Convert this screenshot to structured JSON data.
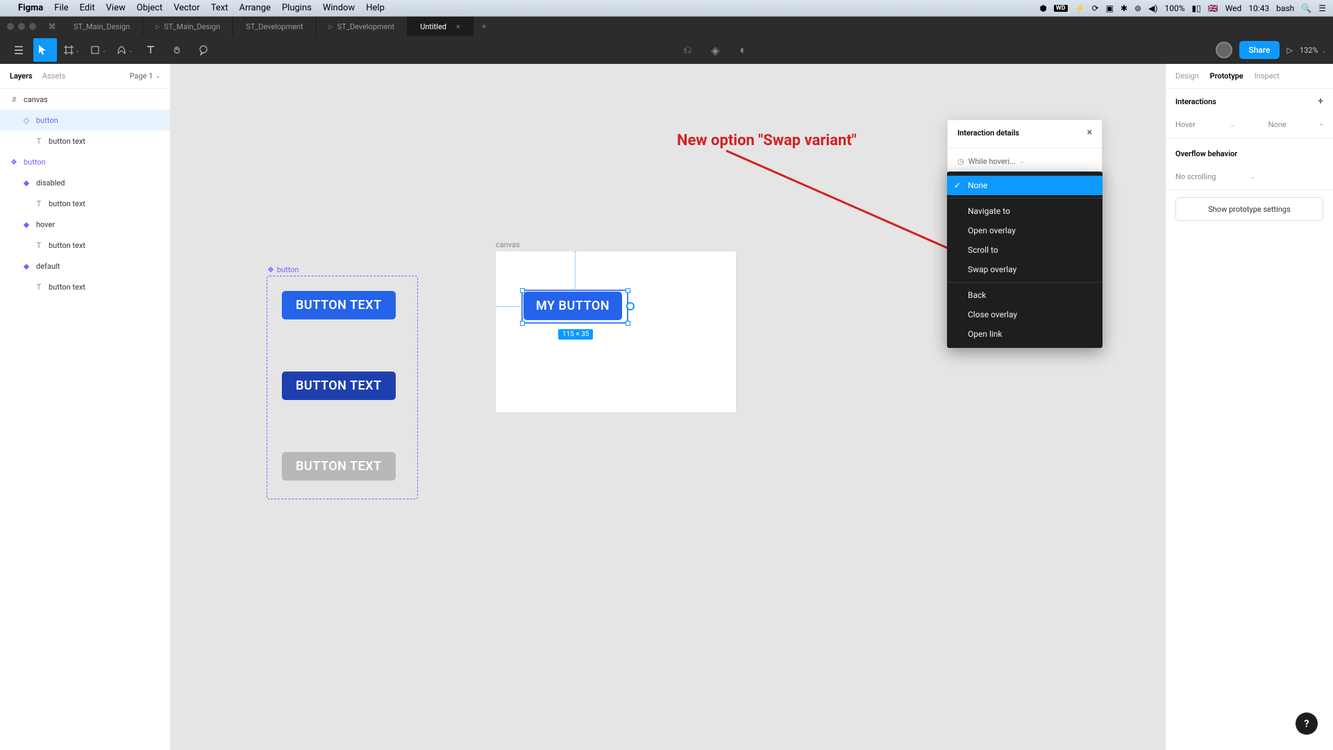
{
  "mac_menu": {
    "app": "Figma",
    "items": [
      "File",
      "Edit",
      "View",
      "Object",
      "Vector",
      "Text",
      "Arrange",
      "Plugins",
      "Window",
      "Help"
    ],
    "battery": "100%",
    "flag": "🇬🇧",
    "day": "Wed",
    "time": "10:43",
    "user": "bash"
  },
  "tabs": {
    "items": [
      {
        "label": "ST_Main_Design",
        "play": false
      },
      {
        "label": "ST_Main_Design",
        "play": true
      },
      {
        "label": "ST_Development",
        "play": false
      },
      {
        "label": "ST_Development",
        "play": true
      },
      {
        "label": "Untitled",
        "play": false,
        "active": true
      }
    ]
  },
  "toolbar": {
    "share_label": "Share",
    "zoom": "132%"
  },
  "left_sidebar": {
    "tab_layers": "Layers",
    "tab_assets": "Assets",
    "page_label": "Page 1",
    "tree": {
      "canvas": "canvas",
      "button_instance": "button",
      "button_instance_text": "button text",
      "button_component": "button",
      "disabled": "disabled",
      "disabled_text": "button text",
      "hover": "hover",
      "hover_text": "button text",
      "default": "default",
      "default_text": "button text"
    }
  },
  "right_sidebar": {
    "tab_design": "Design",
    "tab_prototype": "Prototype",
    "tab_inspect": "Inspect",
    "interactions_label": "Interactions",
    "trigger": "Hover",
    "action": "None",
    "overflow_label": "Overflow behavior",
    "overflow_value": "No scrolling",
    "show_settings": "Show prototype settings"
  },
  "panel": {
    "title": "Interaction details",
    "trigger_value": "While hoveri..."
  },
  "dropdown": {
    "none": "None",
    "navigate": "Navigate to",
    "open_overlay": "Open overlay",
    "scroll": "Scroll to",
    "swap_overlay": "Swap overlay",
    "back": "Back",
    "close_overlay": "Close overlay",
    "open_link": "Open link"
  },
  "canvas": {
    "frame_label": "canvas",
    "component_label": "button",
    "btn_text": "BUTTON TEXT",
    "my_button": "MY BUTTON",
    "size_badge": "115 × 35"
  },
  "annotation": {
    "text": "New option \"Swap variant\""
  },
  "help": "?"
}
